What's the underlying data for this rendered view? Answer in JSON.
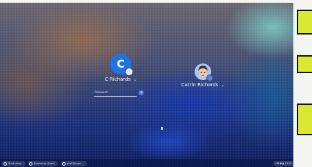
{
  "profiles": [
    {
      "name": "C Richards",
      "initial": "C",
      "color": "#1a73e8",
      "selected": true
    },
    {
      "name": "Catrin Richards",
      "selected": false
    }
  ],
  "password": {
    "placeholder": "Password"
  },
  "shelf": {
    "shut_down": "Shut down",
    "browse_as_guest": "Browse as Guest",
    "add_person": "Add Person",
    "status": "GB  ▼  ▮  13:21"
  },
  "colors": {
    "accent": "#1a73e8",
    "tag": "#d9e830"
  }
}
